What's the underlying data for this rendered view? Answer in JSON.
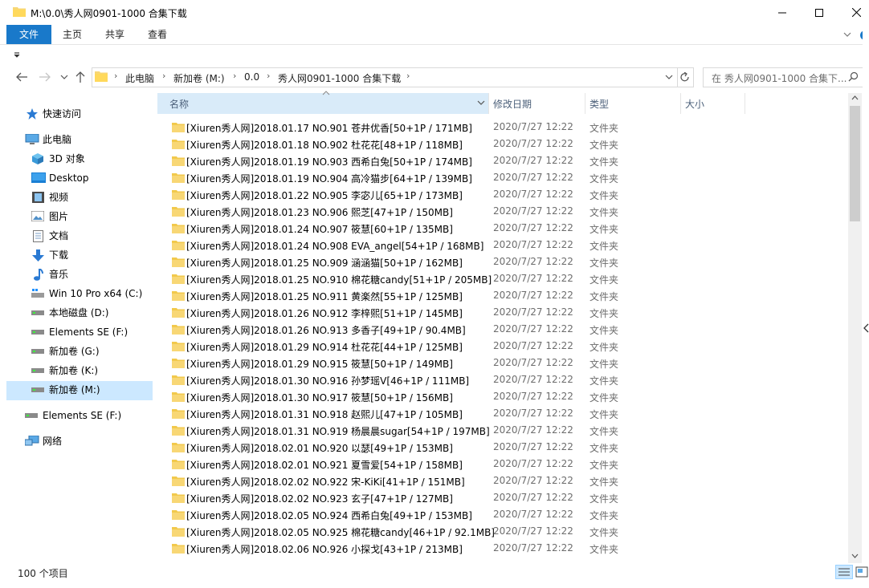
{
  "window": {
    "title": "M:\\0.0\\秀人网0901-1000 合集下载"
  },
  "ribbon": {
    "tabs": [
      "文件",
      "主页",
      "共享",
      "查看"
    ]
  },
  "address": {
    "crumbs": [
      "此电脑",
      "新加卷 (M:)",
      "0.0",
      "秀人网0901-1000 合集下载"
    ]
  },
  "search": {
    "placeholder": "在 秀人网0901-1000 合集下..."
  },
  "nav": {
    "items": [
      {
        "label": "快速访问",
        "icon": "star-icon"
      },
      {
        "label": "此电脑",
        "icon": "computer-icon"
      },
      {
        "label": "3D 对象",
        "icon": "cube-icon"
      },
      {
        "label": "Desktop",
        "icon": "desktop-icon"
      },
      {
        "label": "视频",
        "icon": "video-icon"
      },
      {
        "label": "图片",
        "icon": "pictures-icon"
      },
      {
        "label": "文档",
        "icon": "documents-icon"
      },
      {
        "label": "下载",
        "icon": "download-icon"
      },
      {
        "label": "音乐",
        "icon": "music-icon"
      },
      {
        "label": "Win 10 Pro x64 (C:)",
        "icon": "windows-drive-icon"
      },
      {
        "label": "本地磁盘 (D:)",
        "icon": "drive-icon"
      },
      {
        "label": "Elements SE (F:)",
        "icon": "drive-icon"
      },
      {
        "label": "新加卷 (G:)",
        "icon": "drive-icon"
      },
      {
        "label": "新加卷 (K:)",
        "icon": "drive-icon"
      },
      {
        "label": "新加卷 (M:)",
        "icon": "drive-icon"
      },
      {
        "label": "Elements SE (F:)",
        "icon": "drive-icon"
      },
      {
        "label": "网络",
        "icon": "network-icon"
      }
    ]
  },
  "list": {
    "columns": [
      "名称",
      "修改日期",
      "类型",
      "大小"
    ],
    "rows": [
      {
        "name": "[Xiuren秀人网]2018.01.17 NO.901 苍井优香[50+1P / 171MB]",
        "date": "2020/7/27 12:22",
        "type": "文件夹"
      },
      {
        "name": "[Xiuren秀人网]2018.01.18 NO.902 杜花花[48+1P / 118MB]",
        "date": "2020/7/27 12:22",
        "type": "文件夹"
      },
      {
        "name": "[Xiuren秀人网]2018.01.19 NO.903 西希白兔[50+1P / 174MB]",
        "date": "2020/7/27 12:22",
        "type": "文件夹"
      },
      {
        "name": "[Xiuren秀人网]2018.01.19 NO.904 高冷猫步[64+1P / 139MB]",
        "date": "2020/7/27 12:22",
        "type": "文件夹"
      },
      {
        "name": "[Xiuren秀人网]2018.01.22 NO.905 李宓儿[65+1P / 173MB]",
        "date": "2020/7/27 12:22",
        "type": "文件夹"
      },
      {
        "name": "[Xiuren秀人网]2018.01.23 NO.906 熙芝[47+1P / 150MB]",
        "date": "2020/7/27 12:22",
        "type": "文件夹"
      },
      {
        "name": "[Xiuren秀人网]2018.01.24 NO.907 筱慧[60+1P / 135MB]",
        "date": "2020/7/27 12:22",
        "type": "文件夹"
      },
      {
        "name": "[Xiuren秀人网]2018.01.24 NO.908 EVA_angel[54+1P / 168MB]",
        "date": "2020/7/27 12:22",
        "type": "文件夹"
      },
      {
        "name": "[Xiuren秀人网]2018.01.25 NO.909 涵涵猫[50+1P / 162MB]",
        "date": "2020/7/27 12:22",
        "type": "文件夹"
      },
      {
        "name": "[Xiuren秀人网]2018.01.25 NO.910 棉花糖candy[51+1P / 205MB]",
        "date": "2020/7/27 12:22",
        "type": "文件夹"
      },
      {
        "name": "[Xiuren秀人网]2018.01.25 NO.911 黄楽然[55+1P / 125MB]",
        "date": "2020/7/27 12:22",
        "type": "文件夹"
      },
      {
        "name": "[Xiuren秀人网]2018.01.26 NO.912 李梓熙[51+1P / 145MB]",
        "date": "2020/7/27 12:22",
        "type": "文件夹"
      },
      {
        "name": "[Xiuren秀人网]2018.01.26 NO.913 多香子[49+1P / 90.4MB]",
        "date": "2020/7/27 12:22",
        "type": "文件夹"
      },
      {
        "name": "[Xiuren秀人网]2018.01.29 NO.914 杜花花[44+1P / 125MB]",
        "date": "2020/7/27 12:22",
        "type": "文件夹"
      },
      {
        "name": "[Xiuren秀人网]2018.01.29 NO.915 筱慧[50+1P / 149MB]",
        "date": "2020/7/27 12:22",
        "type": "文件夹"
      },
      {
        "name": "[Xiuren秀人网]2018.01.30 NO.916 孙梦瑶V[46+1P / 111MB]",
        "date": "2020/7/27 12:22",
        "type": "文件夹"
      },
      {
        "name": "[Xiuren秀人网]2018.01.30 NO.917 筱慧[50+1P / 156MB]",
        "date": "2020/7/27 12:22",
        "type": "文件夹"
      },
      {
        "name": "[Xiuren秀人网]2018.01.31 NO.918 赵熙儿[47+1P / 105MB]",
        "date": "2020/7/27 12:22",
        "type": "文件夹"
      },
      {
        "name": "[Xiuren秀人网]2018.01.31 NO.919 杨晨晨sugar[54+1P / 197MB]",
        "date": "2020/7/27 12:22",
        "type": "文件夹"
      },
      {
        "name": "[Xiuren秀人网]2018.02.01 NO.920 以瑟[49+1P / 153MB]",
        "date": "2020/7/27 12:22",
        "type": "文件夹"
      },
      {
        "name": "[Xiuren秀人网]2018.02.01 NO.921 夏雪爱[54+1P / 158MB]",
        "date": "2020/7/27 12:22",
        "type": "文件夹"
      },
      {
        "name": "[Xiuren秀人网]2018.02.02 NO.922 宋-KiKi[41+1P / 151MB]",
        "date": "2020/7/27 12:22",
        "type": "文件夹"
      },
      {
        "name": "[Xiuren秀人网]2018.02.02 NO.923 玄子[47+1P / 127MB]",
        "date": "2020/7/27 12:22",
        "type": "文件夹"
      },
      {
        "name": "[Xiuren秀人网]2018.02.05 NO.924 西希白兔[49+1P / 153MB]",
        "date": "2020/7/27 12:22",
        "type": "文件夹"
      },
      {
        "name": "[Xiuren秀人网]2018.02.05 NO.925 棉花糖candy[46+1P / 92.1MB]",
        "date": "2020/7/27 12:22",
        "type": "文件夹"
      },
      {
        "name": "[Xiuren秀人网]2018.02.06 NO.926 小探戈[43+1P / 213MB]",
        "date": "2020/7/27 12:22",
        "type": "文件夹"
      }
    ]
  },
  "status": {
    "item_count": "100 个项目"
  },
  "colors": {
    "accent": "#1979ca",
    "selection": "#cce8ff",
    "folder": "#f8d775"
  }
}
